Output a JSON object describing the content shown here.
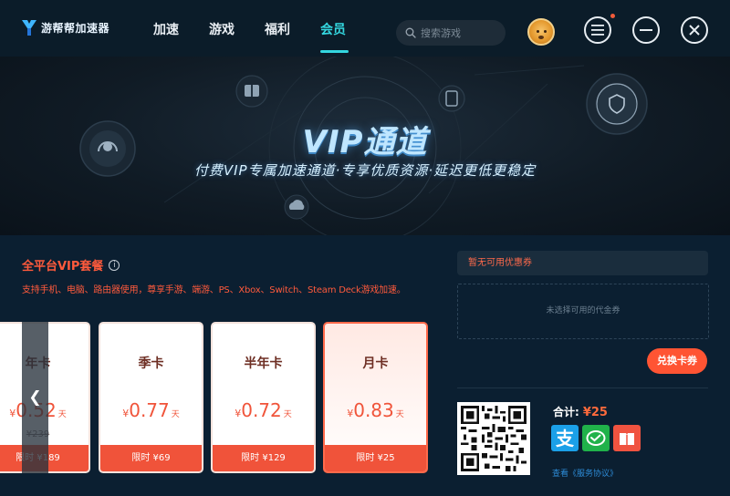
{
  "app": {
    "name": "游帮帮加速器"
  },
  "nav": {
    "items": [
      {
        "label": "加速"
      },
      {
        "label": "游戏"
      },
      {
        "label": "福利"
      },
      {
        "label": "会员"
      }
    ],
    "active": "会员"
  },
  "search": {
    "placeholder": "搜索游戏"
  },
  "banner": {
    "title": "VIP通道",
    "subtitle": "付费VIP专属加速通道·专享优质资源·延迟更低更稳定"
  },
  "plans": {
    "title": "全平台VIP套餐",
    "description": "支持手机、电脑、路由器使用，尊享手游、端游、PS、Xbox、Switch、Steam Deck游戏加速。",
    "currency": "¥",
    "cards": [
      {
        "name": "年卡",
        "price": "0.52",
        "unit": "天",
        "original": "¥239",
        "promo": "限时 ¥189"
      },
      {
        "name": "季卡",
        "price": "0.77",
        "unit": "天",
        "promo": "限时 ¥69"
      },
      {
        "name": "半年卡",
        "price": "0.72",
        "unit": "天",
        "promo": "限时 ¥129"
      },
      {
        "name": "月卡",
        "price": "0.83",
        "unit": "天",
        "promo": "限时 ¥25",
        "selected": true
      }
    ]
  },
  "coupon": {
    "status": "暂无可用优惠券",
    "voucher_placeholder": "未选择可用的代金券",
    "redeem_label": "兑换卡券"
  },
  "payment": {
    "total_label": "合计:",
    "total_amount": "¥25",
    "methods": [
      "alipay",
      "wechat-pay",
      "other-pay"
    ],
    "agreement": "查看《服务协议》"
  },
  "colors": {
    "accent": "#34d7e0",
    "price_red": "#f0533a",
    "alipay": "#1ba0e8",
    "wechat": "#20b24a",
    "other": "#f05340"
  }
}
